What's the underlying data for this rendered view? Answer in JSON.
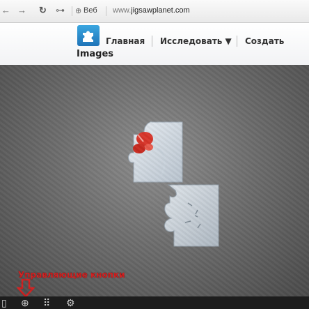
{
  "browser": {
    "back_icon": "back-arrow-icon",
    "forward_icon": "forward-arrow-icon",
    "reload_icon": "reload-icon",
    "key_icon": "key-icon",
    "site_label": "Веб",
    "url_prefix": "www.",
    "url_domain": "jigsawplanet.com"
  },
  "site": {
    "logo_icon": "puzzle-logo-icon",
    "menu": [
      {
        "label": "Главная"
      },
      {
        "label": "Исследовать ▼"
      },
      {
        "label": "Создать"
      }
    ],
    "section_title": "Images"
  },
  "canvas": {
    "annotation": "Управляющие кнопки"
  },
  "toolbar": {
    "icons": [
      "panel-icon",
      "puzzle-piece-icon",
      "pieces-grid-icon",
      "settings-gear-icon"
    ]
  },
  "colors": {
    "accent": "#2b8bd3",
    "annotation_red": "#d11e1e",
    "toolbar_bg": "#1d1d1d"
  }
}
